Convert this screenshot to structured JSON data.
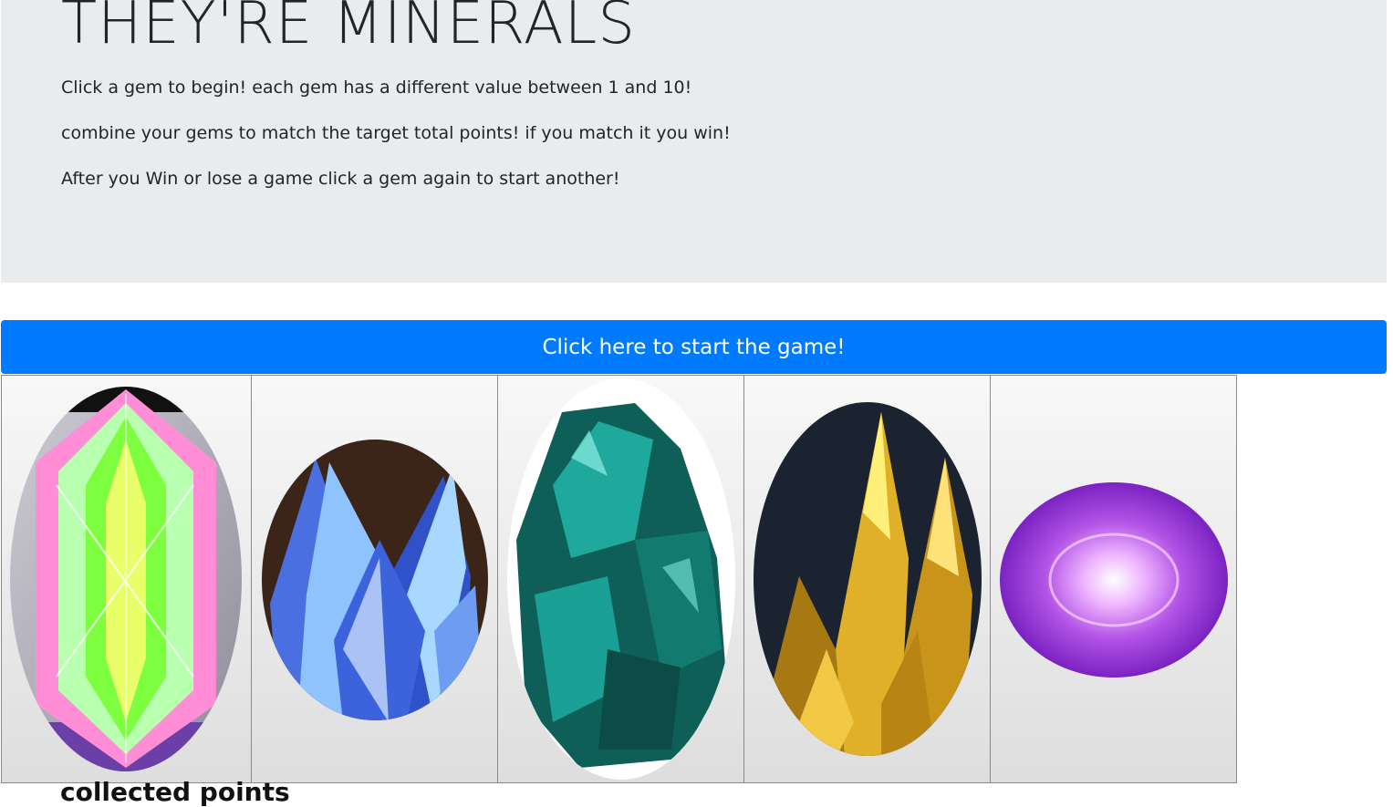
{
  "header": {
    "title": "THEY'RE MINERALS",
    "instructions": [
      "Click a gem to begin! each gem has a different value between 1 and 10!",
      "combine your gems to match the target total points! if you match it you win!",
      "After you Win or lose a game click a gem again to start another!"
    ]
  },
  "start_button": {
    "label": "Click here to start the game!"
  },
  "gems": [
    {
      "name": "pink-green-crystal-gem",
      "colors": [
        "#ff7ad9",
        "#7dff5a",
        "#ffffff"
      ]
    },
    {
      "name": "blue-crystal-cluster-gem",
      "colors": [
        "#2a4fd6",
        "#8fc9ff",
        "#3b2418"
      ]
    },
    {
      "name": "teal-mineral-gem",
      "colors": [
        "#0f6e66",
        "#1fb3a6",
        "#ffffff"
      ]
    },
    {
      "name": "gold-crystal-gem",
      "colors": [
        "#d9a21b",
        "#fff07a",
        "#1b2230"
      ]
    },
    {
      "name": "purple-orb-gem",
      "colors": [
        "#8a2bd0",
        "#f0b8ff",
        "#ffffff"
      ]
    }
  ],
  "bottom_text": "collected points"
}
